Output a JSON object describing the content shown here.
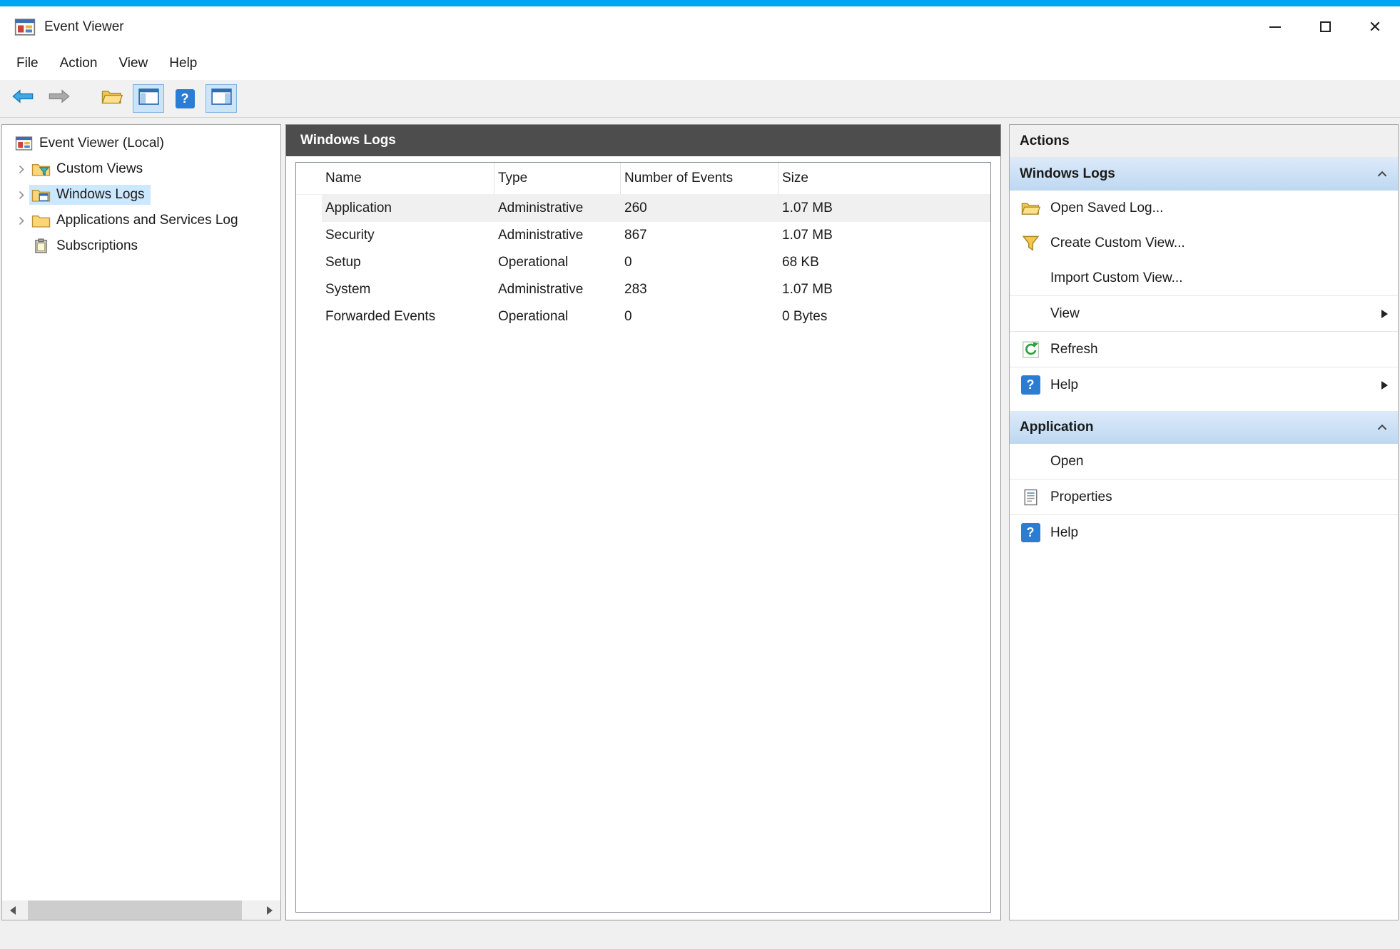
{
  "window": {
    "title": "Event Viewer"
  },
  "colors": {
    "accent": "#00a7ee",
    "tree_selection": "#cce8ff",
    "results_header": "#4d4d4d",
    "row_highlight": "#f0f0f0",
    "action_header_top": "#dceafa",
    "action_header_bottom": "#bdd8f1"
  },
  "menu": {
    "items": [
      "File",
      "Action",
      "View",
      "Help"
    ]
  },
  "toolbar": {
    "buttons": [
      {
        "name": "back"
      },
      {
        "name": "forward"
      },
      {
        "name": "open-saved-log"
      },
      {
        "name": "show-hide-console-tree",
        "toggled": true
      },
      {
        "name": "help"
      },
      {
        "name": "show-hide-action-pane",
        "toggled": true
      }
    ]
  },
  "tree": {
    "root_label": "Event Viewer (Local)",
    "items": [
      {
        "label": "Custom Views"
      },
      {
        "label": "Windows Logs"
      },
      {
        "label": "Applications and Services Log"
      },
      {
        "label": "Subscriptions"
      }
    ]
  },
  "main": {
    "header": "Windows Logs",
    "table": {
      "columns": [
        "Name",
        "Type",
        "Number of Events",
        "Size"
      ],
      "rows": [
        {
          "name": "Application",
          "type": "Administrative",
          "events": "260",
          "size": "1.07 MB"
        },
        {
          "name": "Security",
          "type": "Administrative",
          "events": "867",
          "size": "1.07 MB"
        },
        {
          "name": "Setup",
          "type": "Operational",
          "events": "0",
          "size": "68 KB"
        },
        {
          "name": "System",
          "type": "Administrative",
          "events": "283",
          "size": "1.07 MB"
        },
        {
          "name": "Forwarded Events",
          "type": "Operational",
          "events": "0",
          "size": "0 Bytes"
        }
      ]
    }
  },
  "actions": {
    "title": "Actions",
    "sections": [
      {
        "header": "Windows Logs",
        "items": [
          {
            "label": "Open Saved Log..."
          },
          {
            "label": "Create Custom View..."
          },
          {
            "label": "Import Custom View..."
          },
          {
            "label": "View"
          },
          {
            "label": "Refresh"
          },
          {
            "label": "Help"
          }
        ]
      },
      {
        "header": "Application",
        "items": [
          {
            "label": "Open"
          },
          {
            "label": "Properties"
          },
          {
            "label": "Help"
          }
        ]
      }
    ]
  }
}
